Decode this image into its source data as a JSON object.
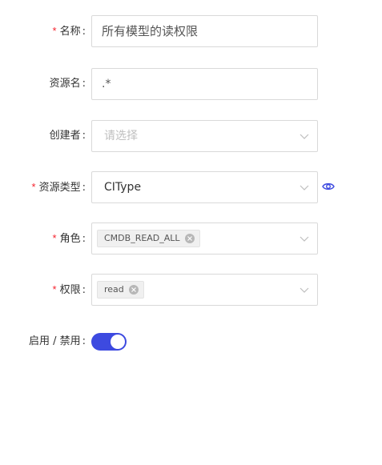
{
  "form": {
    "name": {
      "label": "名称",
      "required": true,
      "value": "所有模型的读权限"
    },
    "resource_name": {
      "label": "资源名",
      "required": false,
      "value": ".*"
    },
    "creator": {
      "label": "创建者",
      "required": false,
      "placeholder": "请选择"
    },
    "resource_type": {
      "label": "资源类型",
      "required": true,
      "value": "CIType"
    },
    "role": {
      "label": "角色",
      "required": true,
      "tags": [
        "CMDB_READ_ALL"
      ]
    },
    "permission": {
      "label": "权限",
      "required": true,
      "tags": [
        "read"
      ]
    },
    "enable": {
      "label": "启用 / 禁用",
      "required": false,
      "enabled": true
    }
  },
  "colon": ":",
  "required_mark": "*",
  "icons": {
    "chevron": "chevron-down-icon",
    "eye": "eye-icon",
    "tag_close": "close-circle-icon"
  },
  "colors": {
    "accent": "#3d4ae0",
    "required": "#f5222d"
  }
}
